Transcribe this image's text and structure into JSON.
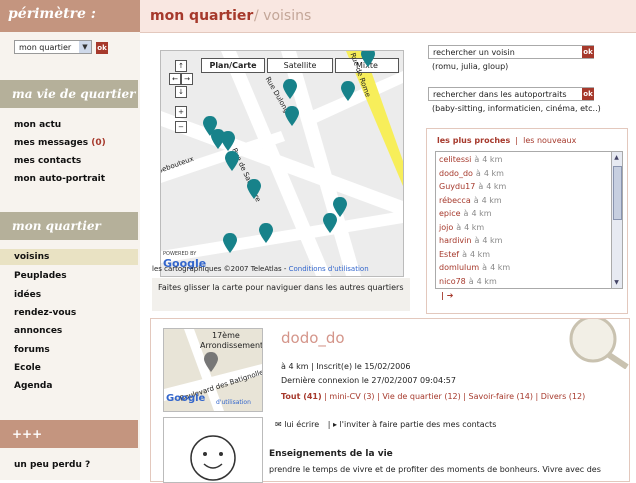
{
  "sidebar": {
    "perimetre_title": "périmètre :",
    "select_value": "mon quartier",
    "ok": "ok",
    "section1_title": "ma vie de quartier",
    "menu1": [
      {
        "label": "mon actu"
      },
      {
        "label": "mes messages",
        "count": "(0)"
      },
      {
        "label": "mes contacts"
      },
      {
        "label": "mon auto-portrait"
      }
    ],
    "section2_title": "mon quartier",
    "menu2": [
      {
        "label": "voisins"
      },
      {
        "label": "Peuplades"
      },
      {
        "label": "idées"
      },
      {
        "label": "rendez-vous"
      },
      {
        "label": "annonces"
      },
      {
        "label": "forums"
      },
      {
        "label": "Ecole"
      },
      {
        "label": "Agenda"
      }
    ],
    "section3_title": "+++",
    "lost": "un peu perdu ?"
  },
  "header": {
    "title": "mon quartier",
    "subtitle": "/ voisins"
  },
  "map": {
    "buttons": [
      "Plan/Carte",
      "Satellite",
      "Mixte"
    ],
    "streets": [
      "Rue Dulong",
      "Rue de Saussure",
      "Rue de Rome",
      "Sebouteux"
    ],
    "powered": "POWERED BY",
    "google": "Google",
    "copyright": "les cartographiques ©2007 TeleAtlas -",
    "terms": "Conditions d'utilisation",
    "caption": "Faites glisser la carte pour naviguer dans les autres quartiers"
  },
  "search": {
    "neighbor_placeholder": "rechercher un voisin",
    "neighbor_hint": "(romu, julia, gloup)",
    "portrait_placeholder": "rechercher dans les autoportraits",
    "portrait_hint": "(baby-sitting, informaticien, cinéma, etc..)"
  },
  "people": {
    "tab_active": "les plus proches",
    "tab_other": "les nouveaux",
    "distance_prefix": "à",
    "items": [
      {
        "name": "celitessi",
        "dist": "4 km"
      },
      {
        "name": "dodo_do",
        "dist": "4 km"
      },
      {
        "name": "Guydu17",
        "dist": "4 km"
      },
      {
        "name": "rébecca",
        "dist": "4 km"
      },
      {
        "name": "epice",
        "dist": "4 km"
      },
      {
        "name": "jojo",
        "dist": "4 km"
      },
      {
        "name": "hardivin",
        "dist": "4 km"
      },
      {
        "name": "Estef",
        "dist": "4 km"
      },
      {
        "name": "domlulum",
        "dist": "4 km"
      },
      {
        "name": "nico78",
        "dist": "4 km"
      }
    ],
    "footer": "| ➔"
  },
  "profile": {
    "name": "dodo_do",
    "line1": "à  4 km   |  Inscrit(e) le 15/02/2006",
    "line2": "Dernière connexion le 27/02/2007 09:04:57",
    "links": [
      {
        "label": "Tout (41)"
      },
      {
        "label": "mini-CV (3)"
      },
      {
        "label": "Vie de quartier (12)"
      },
      {
        "label": "Savoir-faire (14)"
      },
      {
        "label": "Divers (12)"
      }
    ],
    "write": "lui écrire",
    "invite": "l'inviter à faire partie des mes contacts",
    "section_title": "Enseignements de la vie",
    "section_text": "prendre le temps de vivre et de profiter des moments de bonheurs. Vivre avec des",
    "map_label1": "17ème",
    "map_label2": "Arrondissement",
    "map_street": "Boulevard des Batignolles",
    "map_terms": "d'utilisation"
  },
  "colors": {
    "accent": "#a6392c",
    "sidebar_header": "#b5b09a",
    "perimetre": "#c4957f"
  }
}
